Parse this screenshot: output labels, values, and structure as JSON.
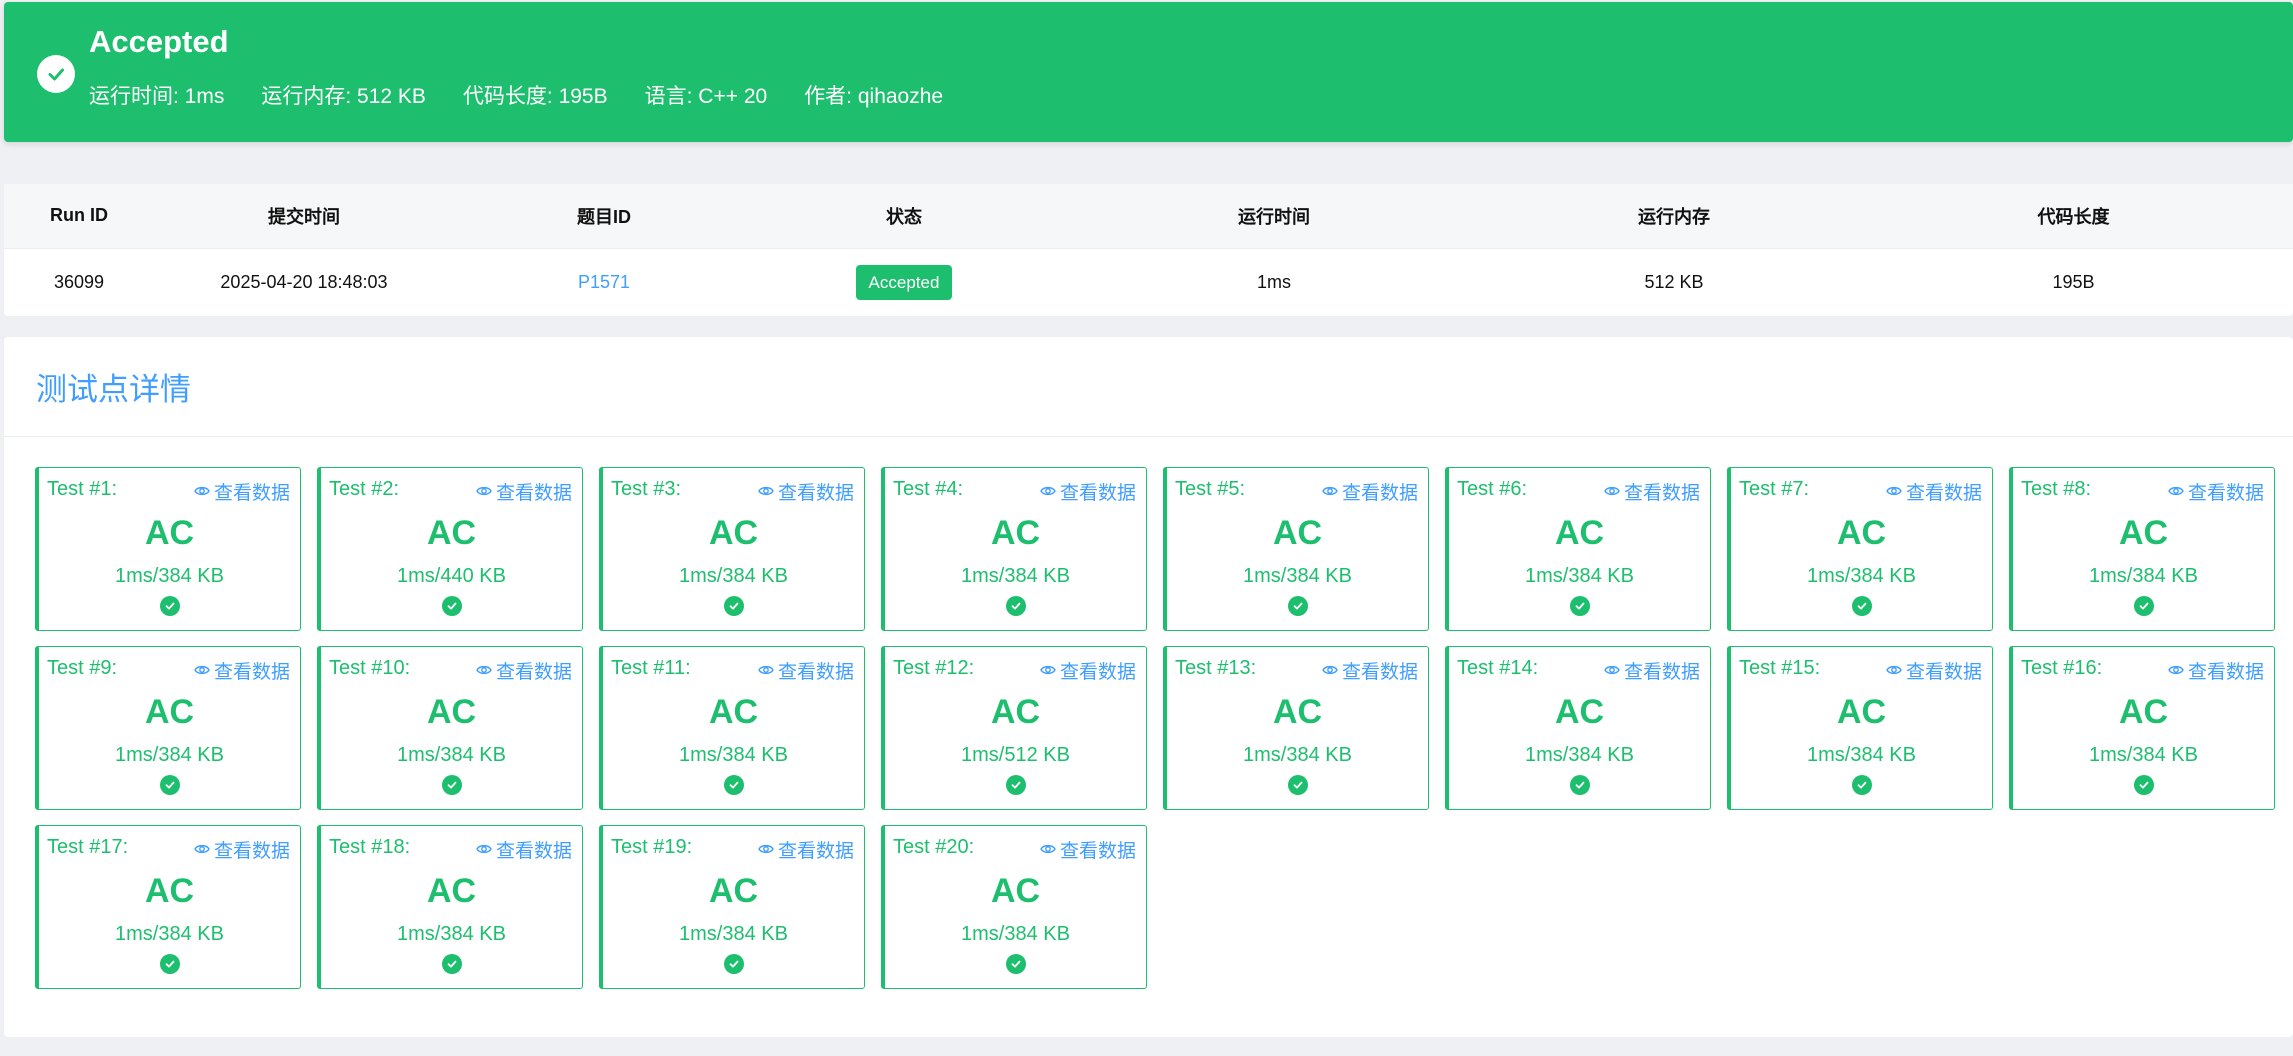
{
  "banner": {
    "status": "Accepted",
    "run_time": "运行时间: 1ms",
    "memory": "运行内存: 512 KB",
    "code_length": "代码长度: 195B",
    "language": "语言: C++ 20",
    "author": "作者: qihaozhe"
  },
  "info_table": {
    "headers": [
      "Run ID",
      "提交时间",
      "题目ID",
      "状态",
      "运行时间",
      "运行内存",
      "代码长度"
    ],
    "row": {
      "run_id": "36099",
      "submit_time": "2025-04-20 18:48:03",
      "problem_id": "P1571",
      "status": "Accepted",
      "run_time": "1ms",
      "memory": "512 KB",
      "code_length": "195B"
    }
  },
  "tests": {
    "title": "测试点详情",
    "view_label": "查看数据",
    "items": [
      {
        "name": "Test #1:",
        "verdict": "AC",
        "usage": "1ms/384 KB"
      },
      {
        "name": "Test #2:",
        "verdict": "AC",
        "usage": "1ms/440 KB"
      },
      {
        "name": "Test #3:",
        "verdict": "AC",
        "usage": "1ms/384 KB"
      },
      {
        "name": "Test #4:",
        "verdict": "AC",
        "usage": "1ms/384 KB"
      },
      {
        "name": "Test #5:",
        "verdict": "AC",
        "usage": "1ms/384 KB"
      },
      {
        "name": "Test #6:",
        "verdict": "AC",
        "usage": "1ms/384 KB"
      },
      {
        "name": "Test #7:",
        "verdict": "AC",
        "usage": "1ms/384 KB"
      },
      {
        "name": "Test #8:",
        "verdict": "AC",
        "usage": "1ms/384 KB"
      },
      {
        "name": "Test #9:",
        "verdict": "AC",
        "usage": "1ms/384 KB"
      },
      {
        "name": "Test #10:",
        "verdict": "AC",
        "usage": "1ms/384 KB"
      },
      {
        "name": "Test #11:",
        "verdict": "AC",
        "usage": "1ms/384 KB"
      },
      {
        "name": "Test #12:",
        "verdict": "AC",
        "usage": "1ms/512 KB"
      },
      {
        "name": "Test #13:",
        "verdict": "AC",
        "usage": "1ms/384 KB"
      },
      {
        "name": "Test #14:",
        "verdict": "AC",
        "usage": "1ms/384 KB"
      },
      {
        "name": "Test #15:",
        "verdict": "AC",
        "usage": "1ms/384 KB"
      },
      {
        "name": "Test #16:",
        "verdict": "AC",
        "usage": "1ms/384 KB"
      },
      {
        "name": "Test #17:",
        "verdict": "AC",
        "usage": "1ms/384 KB"
      },
      {
        "name": "Test #18:",
        "verdict": "AC",
        "usage": "1ms/384 KB"
      },
      {
        "name": "Test #19:",
        "verdict": "AC",
        "usage": "1ms/384 KB"
      },
      {
        "name": "Test #20:",
        "verdict": "AC",
        "usage": "1ms/384 KB"
      }
    ]
  },
  "colors": {
    "accent_green": "#1dbf6e",
    "link_blue": "#409eff"
  },
  "icons": {
    "banner": "check-circle-icon",
    "view": "eye-icon",
    "test_status": "check-circle-icon"
  }
}
